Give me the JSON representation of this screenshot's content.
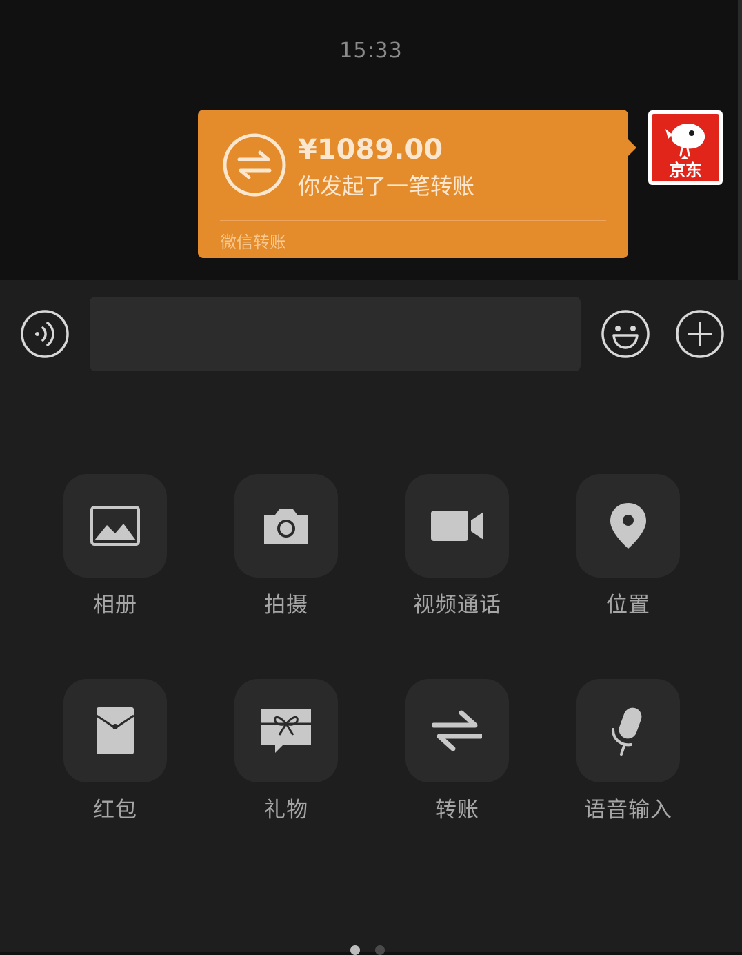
{
  "chat": {
    "timestamp": "15:33",
    "transfer": {
      "amount": "¥1089.00",
      "description": "你发起了一笔转账",
      "footer": "微信转账"
    },
    "avatar": {
      "brand_text": "京东",
      "icon": "jd-dog-logo"
    }
  },
  "input_bar": {
    "voice_icon": "voice-mode-icon",
    "input_value": "",
    "emoji_icon": "emoji-icon",
    "more_icon": "plus-icon"
  },
  "actions": {
    "items": [
      {
        "label": "相册",
        "icon": "photo-album-icon"
      },
      {
        "label": "拍摄",
        "icon": "camera-icon"
      },
      {
        "label": "视频通话",
        "icon": "video-call-icon"
      },
      {
        "label": "位置",
        "icon": "location-pin-icon"
      },
      {
        "label": "红包",
        "icon": "red-packet-icon"
      },
      {
        "label": "礼物",
        "icon": "gift-icon"
      },
      {
        "label": "转账",
        "icon": "transfer-icon"
      },
      {
        "label": "语音输入",
        "icon": "microphone-icon"
      }
    ]
  },
  "pager": {
    "current_page": 1,
    "total_pages": 2
  },
  "colors": {
    "transfer_bubble": "#e48c2c",
    "panel_bg": "#1e1e1e",
    "chat_bg": "#111111",
    "jd_red": "#e1251b"
  }
}
